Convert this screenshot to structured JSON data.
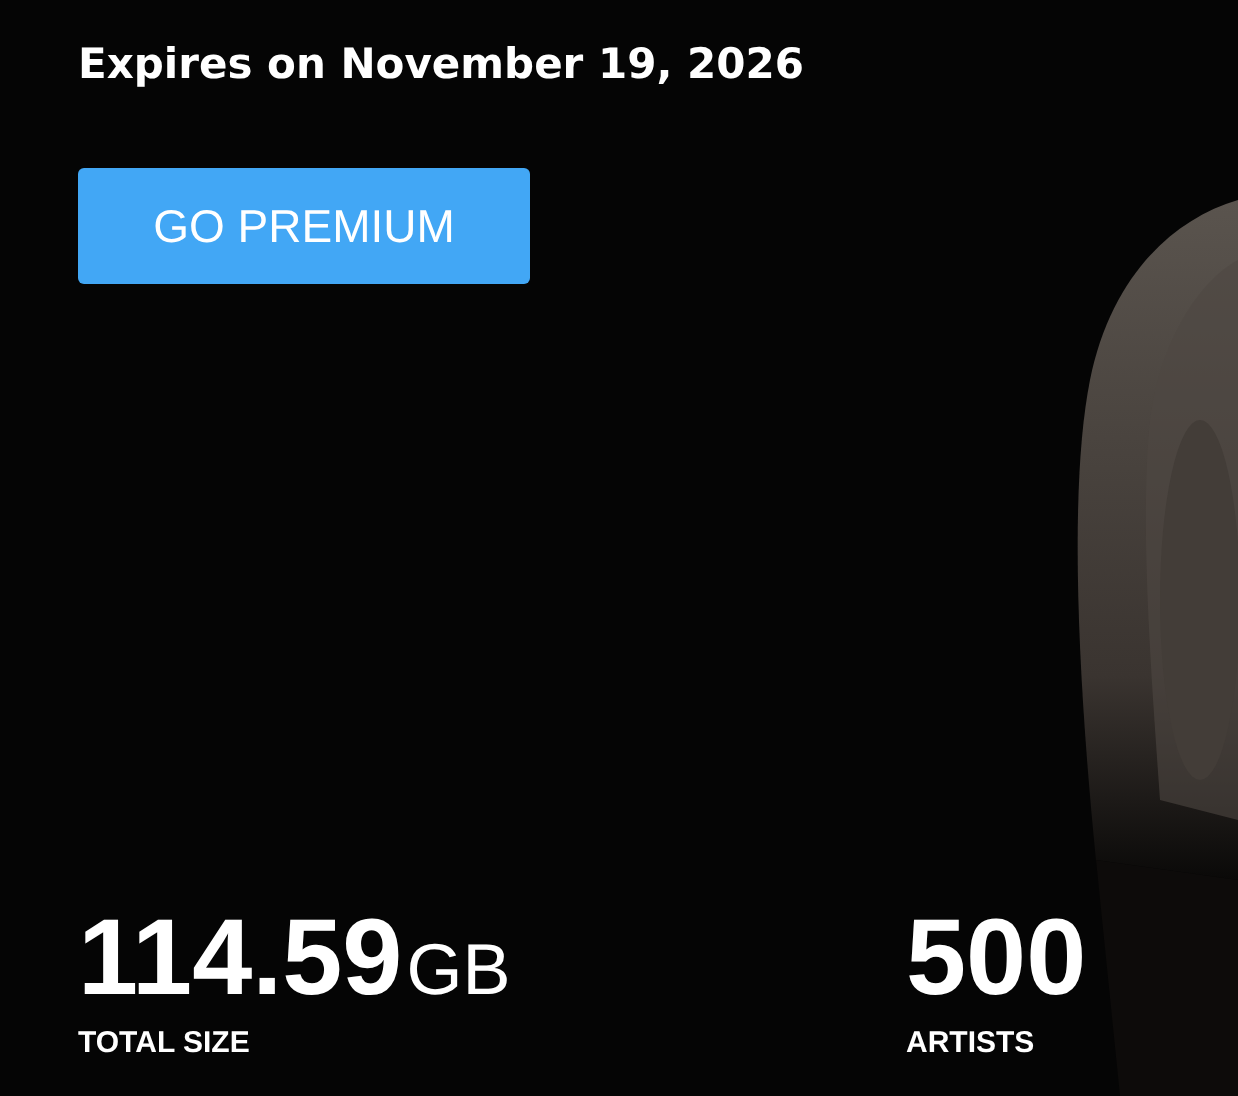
{
  "expiry": {
    "text": "Expires on November 19, 2026"
  },
  "button": {
    "label": "GO PREMIUM"
  },
  "stats": [
    {
      "value": "114.59",
      "unit": "GB",
      "label": "TOTAL SIZE"
    },
    {
      "value": "500",
      "label": "ARTISTS"
    }
  ]
}
